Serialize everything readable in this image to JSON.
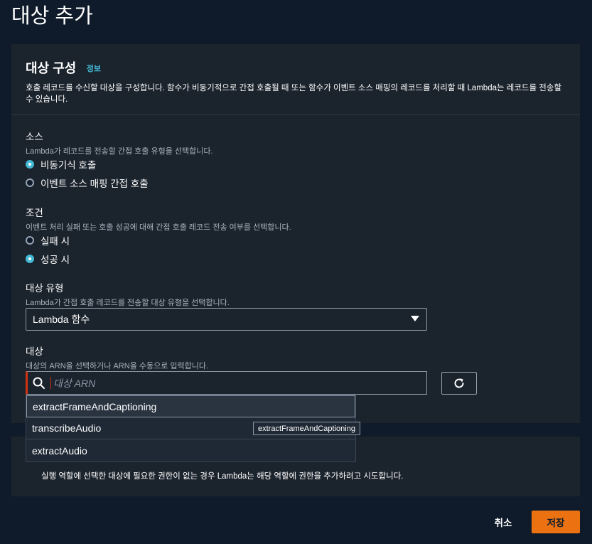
{
  "page": {
    "title": "대상 추가"
  },
  "panel": {
    "title": "대상 구성",
    "info_link": "정보",
    "description": "호출 레코드를 수신할 대상을 구성합니다. 함수가 비동기적으로 간접 호출될 때 또는 함수가 이벤트 소스 매핑의 레코드를 처리할 때 Lambda는 레코드를 전송할 수 있습니다."
  },
  "source": {
    "label": "소스",
    "description": "Lambda가 레코드를 전송할 간접 호출 유형을 선택합니다.",
    "options": [
      {
        "label": "비동기식 호출",
        "checked": true
      },
      {
        "label": "이벤트 소스 매핑 간접 호출",
        "checked": false
      }
    ]
  },
  "condition": {
    "label": "조건",
    "description": "이벤트 처리 실패 또는 호출 성공에 대해 간접 호출 레코드 전송 여부를 선택합니다.",
    "options": [
      {
        "label": "실패 시",
        "checked": false
      },
      {
        "label": "성공 시",
        "checked": true
      }
    ]
  },
  "destination_type": {
    "label": "대상 유형",
    "description": "Lambda가 간접 호출 레코드를 전송할 대상 유형을 선택합니다.",
    "selected": "Lambda 함수"
  },
  "destination": {
    "label": "대상",
    "description": "대상의 ARN을 선택하거나 ARN을 수동으로 입력합니다.",
    "placeholder": "대상 ARN",
    "options": [
      "extractFrameAndCaptioning",
      "transcribeAudio",
      "extractAudio"
    ],
    "tooltip": "extractFrameAndCaptioning"
  },
  "permissions_note": "실행 역할에 선택한 대상에 필요한 권한이 없는 경우 Lambda는 해당 역할에 권한을 추가하려고 시도합니다.",
  "footer": {
    "cancel_label": "취소",
    "save_label": "저장"
  },
  "colors": {
    "accent": "#44b9d6",
    "primary_button": "#ec7211",
    "error": "#d13212"
  }
}
